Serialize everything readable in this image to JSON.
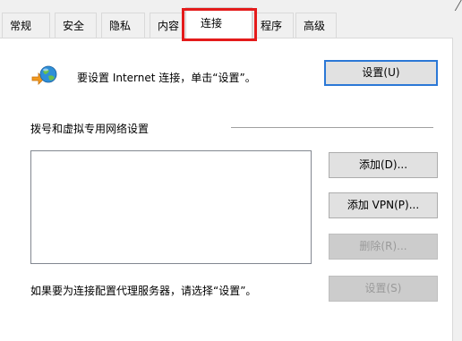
{
  "tabs": [
    {
      "label": "常规"
    },
    {
      "label": "安全"
    },
    {
      "label": "隐私"
    },
    {
      "label": "内容"
    },
    {
      "label": "连接"
    },
    {
      "label": "程序"
    },
    {
      "label": "高级"
    }
  ],
  "active_tab": "连接",
  "setup": {
    "text": "要设置 Internet 连接，单击“设置”。",
    "button": "设置(U)"
  },
  "dialup": {
    "label": "拨号和虚拟专用网络设置",
    "add_button": "添加(D)...",
    "add_vpn_button": "添加 VPN(P)...",
    "remove_button": "删除(R)...",
    "settings_button": "设置(S)"
  },
  "proxy": {
    "text": "如果要为连接配置代理服务器，请选择“设置”。"
  },
  "colors": {
    "highlight": "#e41b1b",
    "focus_border": "#2b78d6"
  }
}
